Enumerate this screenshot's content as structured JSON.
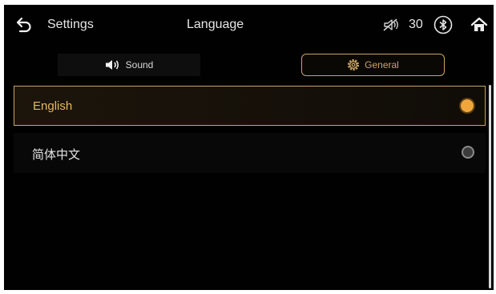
{
  "header": {
    "back_icon": "back-arrow-icon",
    "settings_label": "Settings",
    "title": "Language",
    "volume_value": "30",
    "status_icons": [
      "mute-icon",
      "bluetooth-icon"
    ],
    "home_icon": "home-icon"
  },
  "tabs": [
    {
      "label": "Sound",
      "icon": "speaker-icon",
      "selected": false
    },
    {
      "label": "General",
      "icon": "gear-icon",
      "selected": true
    }
  ],
  "languages": [
    {
      "label": "English",
      "selected": true
    },
    {
      "label": "简体中文",
      "selected": false
    }
  ],
  "colors": {
    "accent": "#c9a467",
    "selected_text": "#e8b85e",
    "radio_on": "#f0a63a",
    "background": "#010101"
  }
}
